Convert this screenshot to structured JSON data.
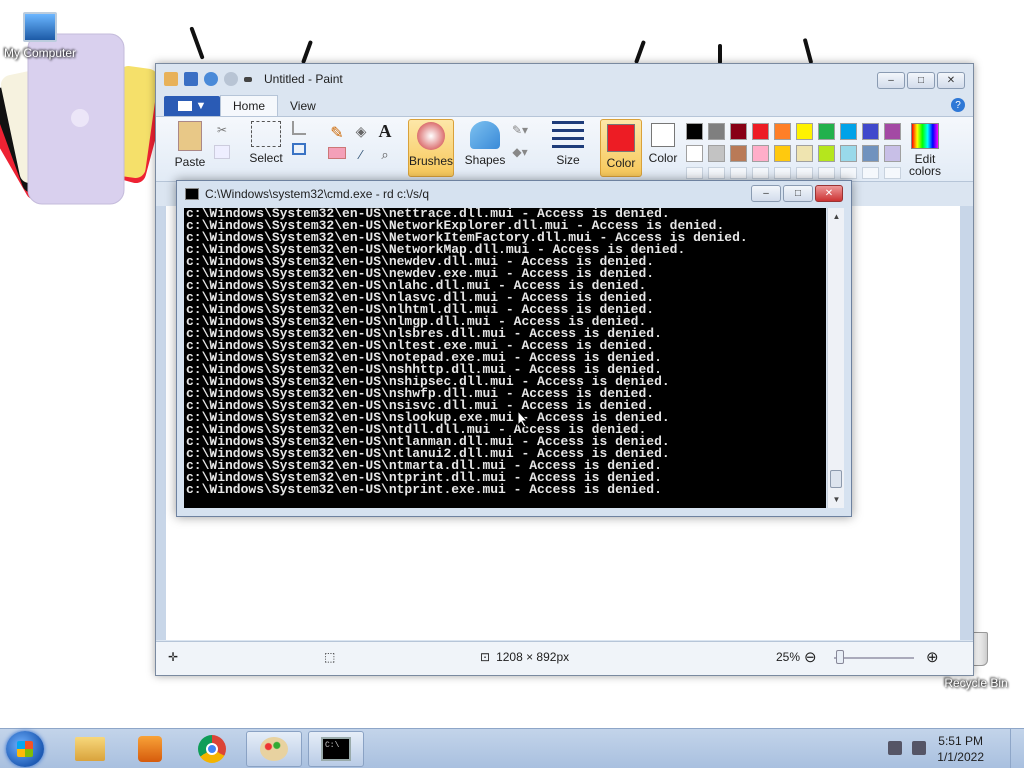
{
  "desktop": {
    "icons": [
      {
        "label": "My Computer"
      },
      {
        "label": "Recycle Bin"
      }
    ]
  },
  "paint": {
    "title": "Untitled - Paint",
    "file_tab": "▼",
    "tabs": [
      "Home",
      "View"
    ],
    "help": "?",
    "ribbon": {
      "paste": "Paste",
      "select": "Select",
      "brushes": "Brushes",
      "shapes": "Shapes",
      "size": "Size",
      "color1": "Color",
      "color2": "Color",
      "edit_colors_line1": "Edit",
      "edit_colors_line2": "colors"
    },
    "palette": [
      "#000000",
      "#7f7f7f",
      "#880015",
      "#ed1c24",
      "#ff7f27",
      "#fff200",
      "#22b14c",
      "#00a2e8",
      "#3f48cc",
      "#a349a4",
      "#ffffff",
      "#c3c3c3",
      "#b97a57",
      "#ffaec9",
      "#ffc90e",
      "#efe4b0",
      "#b5e61d",
      "#99d9ea",
      "#7092be",
      "#c8bfe7"
    ],
    "primary_color": "#ed1c24",
    "status": {
      "size": "1208 × 892px",
      "zoom": "25%",
      "zoom_minus": "⊖",
      "zoom_plus": "⊕"
    }
  },
  "cmd": {
    "title": "C:\\Windows\\system32\\cmd.exe - rd  c:\\/s/q",
    "lines": [
      "c:\\Windows\\System32\\en-US\\nettrace.dll.mui - Access is denied.",
      "c:\\Windows\\System32\\en-US\\NetworkExplorer.dll.mui - Access is denied.",
      "c:\\Windows\\System32\\en-US\\NetworkItemFactory.dll.mui - Access is denied.",
      "c:\\Windows\\System32\\en-US\\NetworkMap.dll.mui - Access is denied.",
      "c:\\Windows\\System32\\en-US\\newdev.dll.mui - Access is denied.",
      "c:\\Windows\\System32\\en-US\\newdev.exe.mui - Access is denied.",
      "c:\\Windows\\System32\\en-US\\nlahc.dll.mui - Access is denied.",
      "c:\\Windows\\System32\\en-US\\nlasvc.dll.mui - Access is denied.",
      "c:\\Windows\\System32\\en-US\\nlhtml.dll.mui - Access is denied.",
      "c:\\Windows\\System32\\en-US\\nlmgp.dll.mui - Access is denied.",
      "c:\\Windows\\System32\\en-US\\nlsbres.dll.mui - Access is denied.",
      "c:\\Windows\\System32\\en-US\\nltest.exe.mui - Access is denied.",
      "c:\\Windows\\System32\\en-US\\notepad.exe.mui - Access is denied.",
      "c:\\Windows\\System32\\en-US\\nshhttp.dll.mui - Access is denied.",
      "c:\\Windows\\System32\\en-US\\nshipsec.dll.mui - Access is denied.",
      "c:\\Windows\\System32\\en-US\\nshwfp.dll.mui - Access is denied.",
      "c:\\Windows\\System32\\en-US\\nsisvc.dll.mui - Access is denied.",
      "c:\\Windows\\System32\\en-US\\nslookup.exe.mui - Access is denied.",
      "c:\\Windows\\System32\\en-US\\ntdll.dll.mui - Access is denied.",
      "c:\\Windows\\System32\\en-US\\ntlanman.dll.mui - Access is denied.",
      "c:\\Windows\\System32\\en-US\\ntlanui2.dll.mui - Access is denied.",
      "c:\\Windows\\System32\\en-US\\ntmarta.dll.mui - Access is denied.",
      "c:\\Windows\\System32\\en-US\\ntprint.dll.mui - Access is denied.",
      "c:\\Windows\\System32\\en-US\\ntprint.exe.mui - Access is denied."
    ]
  },
  "taskbar": {
    "time": "5:51 PM",
    "date": "1/1/2022",
    "apps": [
      "explorer-icon",
      "media-player-icon",
      "chrome-icon",
      "paint-icon",
      "cmd-icon"
    ]
  }
}
